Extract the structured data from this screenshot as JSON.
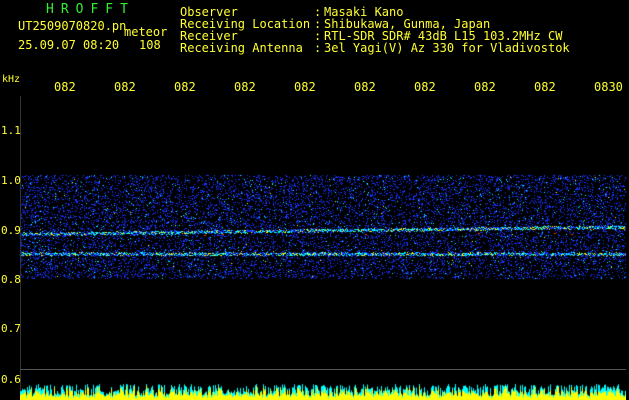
{
  "header": {
    "app_title": "HROFFT",
    "filename": "UT2509070820.pn",
    "mode_label": "meteor",
    "datetime": "25.09.07 08:20",
    "count": "108"
  },
  "info": [
    {
      "key": "Observer",
      "value": "Masaki Kano"
    },
    {
      "key": "Receiving Location",
      "value": "Shibukawa, Gunma, Japan"
    },
    {
      "key": "Receiver",
      "value": "RTL-SDR SDR# 43dB L15 103.2MHz CW"
    },
    {
      "key": "Receiving Antenna",
      "value": "3el Yagi(V) Az 330 for Vladivostok"
    }
  ],
  "axis": {
    "unit": "kHz",
    "time_ticks": [
      "082",
      "082",
      "082",
      "082",
      "082",
      "082",
      "082",
      "082",
      "082",
      "0830"
    ],
    "freq_ticks": [
      "1.1",
      "1.0",
      "0.9",
      "0.8",
      "0.7",
      "0.6"
    ]
  },
  "spectrogram": {
    "noise_band_khz": [
      0.8,
      1.01
    ],
    "signal_lines_khz": [
      0.89,
      0.85
    ],
    "colors": {
      "background": "#000000",
      "noise": "#1a33ff",
      "strong": "#00ffff",
      "peak": "#ffff00",
      "hot": "#ff3300",
      "text": "#ffff33",
      "title": "#33ee33"
    }
  }
}
